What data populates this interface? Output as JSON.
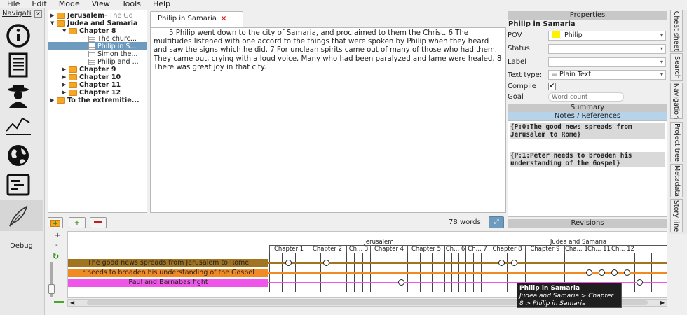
{
  "menu": [
    "File",
    "Edit",
    "Mode",
    "View",
    "Tools",
    "Help"
  ],
  "nav": {
    "title": "Navigati",
    "debug": "Debug"
  },
  "tree": [
    {
      "label": "Jerusalem",
      "extra": " - The Go"
    },
    {
      "label": "Judea and Samaria"
    },
    {
      "label": "Chapter 8"
    },
    {
      "label": "The churc..."
    },
    {
      "label": "Philip in S..."
    },
    {
      "label": "Simon the..."
    },
    {
      "label": "Philip and ..."
    },
    {
      "label": "Chapter 9"
    },
    {
      "label": "Chapter 10"
    },
    {
      "label": "Chapter 11"
    },
    {
      "label": "Chapter 12"
    },
    {
      "label": "To the extremitie..."
    }
  ],
  "editor": {
    "tab_title": "Philip in Samaria",
    "tab_close": "×",
    "text": "5 Philip went down to the city of Samaria, and proclaimed to them the Christ. 6 The multitudes listened with one accord to the things that were spoken by Philip when they heard and saw the signs which he did. 7 For unclean spirits came out of many of those who had them. They came out, crying with a loud voice. Many who had been paralyzed and lame were healed. 8 There was great joy in that city.",
    "word_count": "78 words"
  },
  "properties": {
    "header": "Properties",
    "item_title": "Philip in Samaria",
    "pov_label": "POV",
    "pov_value": "Philip",
    "status_label": "Status",
    "status_value": "",
    "label_label": "Label",
    "label_value": "",
    "text_type_label": "Text type:",
    "text_type_value": "Plain Text",
    "compile_label": "Compile",
    "compile_check": "✔",
    "goal_label": "Goal",
    "goal_placeholder": "Word count",
    "summary_header": "Summary",
    "notes_header": "Notes / References",
    "notes": [
      "{P:0:The good news spreads from Jerusalem to Rome}",
      "{P:1:Peter needs to broaden his understanding of the Gospel}"
    ],
    "revisions_header": "Revisions"
  },
  "side_tabs": [
    "Cheat sheet",
    "Search",
    "Navigation",
    "Project tree",
    "Metadata",
    "Story line"
  ],
  "storyline": {
    "groups": [
      "Jerusalem",
      "Judea and Samaria"
    ],
    "chapters": [
      "Chapter 1",
      "Chapter 2",
      "Ch... 3",
      "Chapter 4",
      "Chapter 5",
      "Ch... 6",
      "Ch... 7",
      "Chapter 8",
      "Chapter 9",
      "Cha... 10",
      "Ch... 11",
      "Ch... 12"
    ],
    "plotlines": [
      {
        "label": "The good news spreads from Jerusalem to Rome",
        "color": "#a07420"
      },
      {
        "label": "r needs to broaden his understanding of the Gospel",
        "color": "#f08a24"
      },
      {
        "label": "Paul and Barnabas fight",
        "color": "#ee55e8"
      }
    ],
    "tooltip_title": "Philip in Samaria",
    "tooltip_path": "Judea and Samaria > Chapter 8 > Philip in Samaria"
  },
  "colors": {
    "selection": "#6e9bbd",
    "accent_header": "#b6d3ea"
  }
}
